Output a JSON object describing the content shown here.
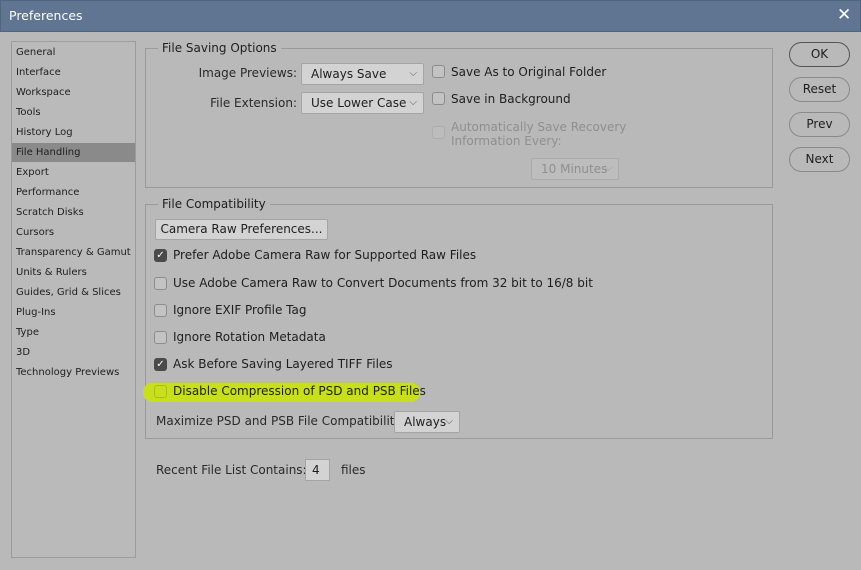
{
  "window": {
    "title": "Preferences"
  },
  "sidebar": {
    "items": [
      "General",
      "Interface",
      "Workspace",
      "Tools",
      "History Log",
      "File Handling",
      "Export",
      "Performance",
      "Scratch Disks",
      "Cursors",
      "Transparency & Gamut",
      "Units & Rulers",
      "Guides, Grid & Slices",
      "Plug-Ins",
      "Type",
      "3D",
      "Technology Previews"
    ],
    "selected": "File Handling"
  },
  "file_saving": {
    "legend": "File Saving Options",
    "image_previews_label": "Image Previews:",
    "image_previews_value": "Always Save",
    "file_extension_label": "File Extension:",
    "file_extension_value": "Use Lower Case",
    "save_as_original": {
      "label": "Save As to Original Folder",
      "checked": false
    },
    "save_in_background": {
      "label": "Save in Background",
      "checked": false
    },
    "auto_save": {
      "label_line1": "Automatically Save Recovery",
      "label_line2": "Information Every:",
      "checked": false,
      "disabled": true
    },
    "auto_save_interval": "10 Minutes"
  },
  "file_compat": {
    "legend": "File Compatibility",
    "camera_raw_button": "Camera Raw Preferences...",
    "options": [
      {
        "label": "Prefer Adobe Camera Raw for Supported Raw Files",
        "checked": true
      },
      {
        "label": "Use Adobe Camera Raw to Convert Documents from 32 bit to 16/8 bit",
        "checked": false
      },
      {
        "label": "Ignore EXIF Profile Tag",
        "checked": false
      },
      {
        "label": "Ignore Rotation Metadata",
        "checked": false
      },
      {
        "label": "Ask Before Saving Layered TIFF Files",
        "checked": true
      },
      {
        "label": "Disable Compression of PSD and PSB Files",
        "checked": false,
        "highlighted": true
      }
    ],
    "maximize_label": "Maximize PSD and PSB File Compatibility:",
    "maximize_value": "Always"
  },
  "recent": {
    "label": "Recent File List Contains:",
    "value": "4",
    "suffix": "files"
  },
  "buttons": {
    "ok": "OK",
    "reset": "Reset",
    "prev": "Prev",
    "next": "Next"
  },
  "colors": {
    "highlight": "#c8e01c",
    "titlebar": "#5f7591",
    "selected_item": "#8a8a8a"
  }
}
